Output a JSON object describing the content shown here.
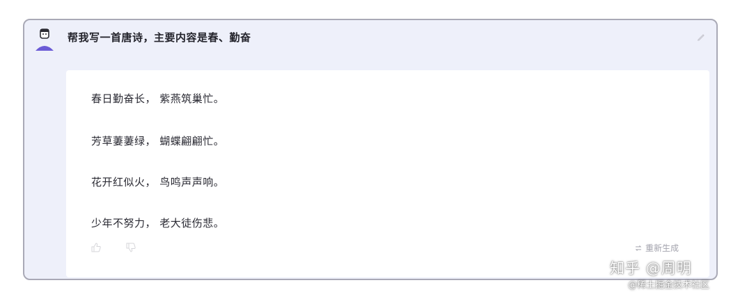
{
  "conversation": {
    "user_prompt": "帮我写一首唐诗，主要内容是春、勤奋",
    "response_lines": [
      "春日勤奋长， 紫燕筑巢忙。",
      "芳草萋萋绿， 蝴蝶翩翩忙。",
      "花开红似火， 鸟鸣声声响。",
      "少年不努力， 老大徒伤悲。"
    ],
    "regenerate_label": "重新生成"
  },
  "icons": {
    "avatar": "user-avatar",
    "edit": "pencil-icon",
    "thumb_up": "thumb-up-icon",
    "thumb_down": "thumb-down-icon",
    "regenerate": "refresh-icon"
  },
  "watermark": {
    "line1": "知乎 @周明",
    "line2": "@稀土掘金技术社区"
  },
  "colors": {
    "frame_border": "#a9a9b6",
    "frame_bg": "#eef0fa",
    "card_bg": "#ffffff",
    "avatar_accent": "#6b5bd6"
  }
}
